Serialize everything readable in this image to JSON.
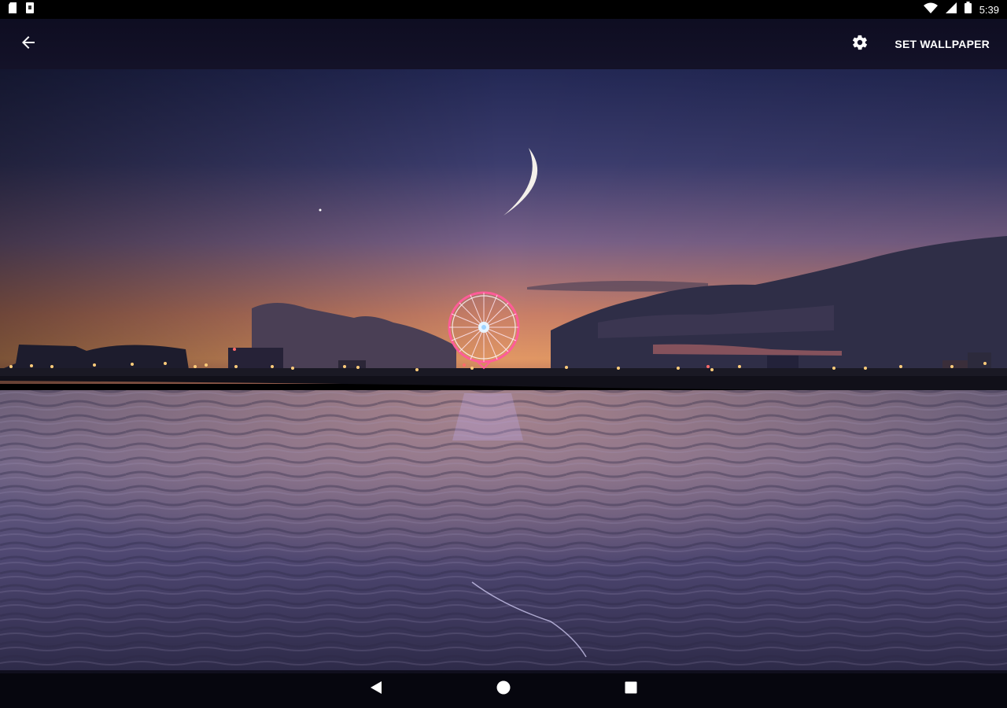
{
  "status_bar": {
    "time": "5:39",
    "left_icons": [
      "sd-card-icon",
      "notification-icon"
    ],
    "right_icons": [
      "wifi-icon",
      "signal-icon",
      "battery-icon"
    ]
  },
  "app_bar": {
    "back_icon": "arrow-back-icon",
    "settings_icon": "gear-icon",
    "set_wallpaper_label": "SET WALLPAPER"
  },
  "wallpaper": {
    "description_icon": "preview-image",
    "colors": {
      "sky_top": "#2a2f5c",
      "sky_mid": "#6a5a86",
      "sky_horizon": "#d88a5e",
      "water": "#4a4468",
      "ferris_wheel": "#ff4f8e"
    }
  },
  "nav_bar": {
    "back_icon": "nav-back-icon",
    "home_icon": "nav-home-icon",
    "recents_icon": "nav-recents-icon"
  }
}
